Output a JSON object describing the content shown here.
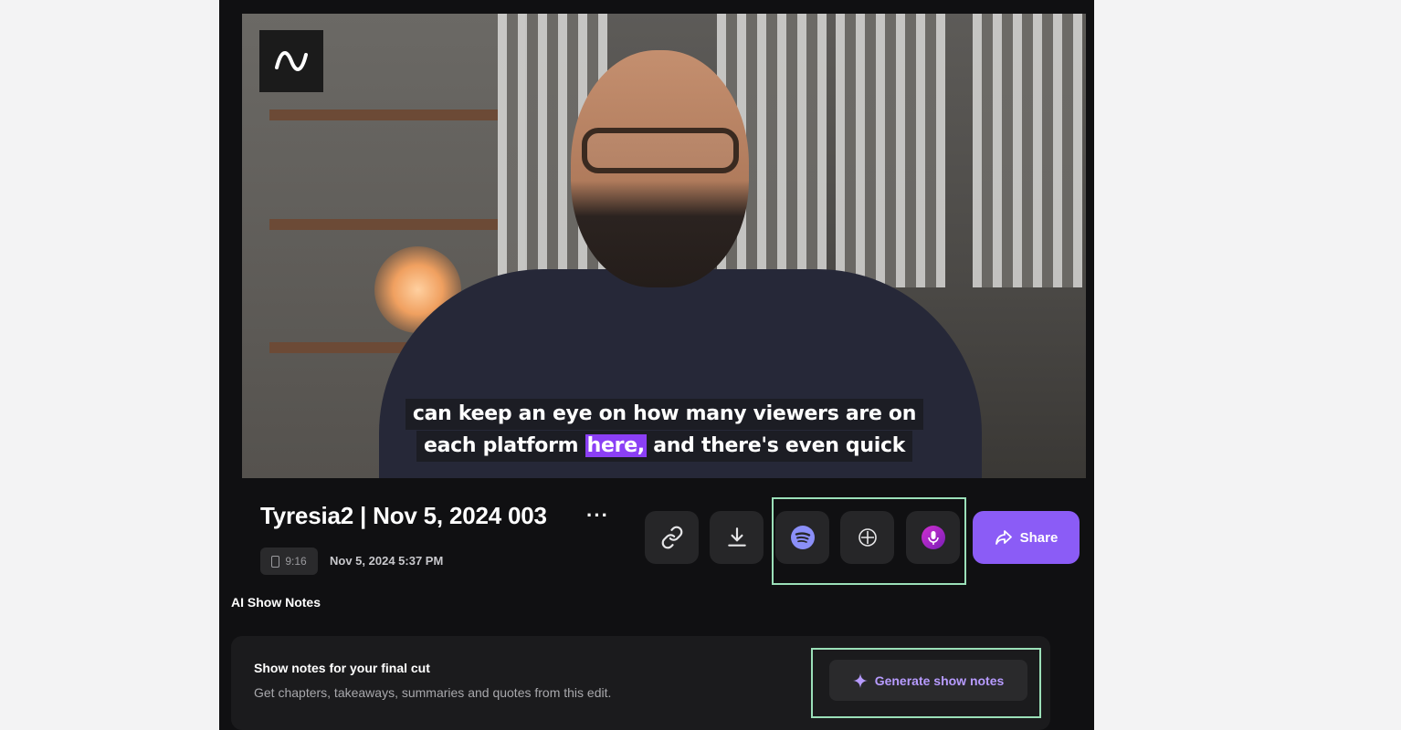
{
  "video": {
    "logo_icon": "waveform-icon",
    "caption_line1": "can keep an eye on how many viewers are on",
    "caption_line2_before": "each platform",
    "caption_line2_highlight": "here,",
    "caption_line2_after": "and there's even quick",
    "highlight_color": "#8b3ff5"
  },
  "project": {
    "title": "Tyresia2 | Nov 5, 2024 003",
    "more_label": "···",
    "aspect_ratio": "9:16",
    "date": "Nov 5, 2024 5:37 PM"
  },
  "actions": {
    "link_icon": "link-icon",
    "download_icon": "download-icon",
    "spotify_icon": "spotify-icon",
    "add_icon": "add-circle-icon",
    "podcast_icon": "podcast-mic-icon",
    "share_label": "Share",
    "share_color": "#8b5cf6"
  },
  "show_notes": {
    "section_label": "AI Show Notes",
    "card_title": "Show notes for your final cut",
    "card_subtitle": "Get chapters, takeaways, summaries and quotes from this edit.",
    "generate_label": "Generate show notes",
    "generate_icon": "sparkle-icon"
  },
  "colors": {
    "annotation_outline": "#9be0b9",
    "panel_bg": "#101012",
    "page_bg": "#f3f3f4"
  }
}
